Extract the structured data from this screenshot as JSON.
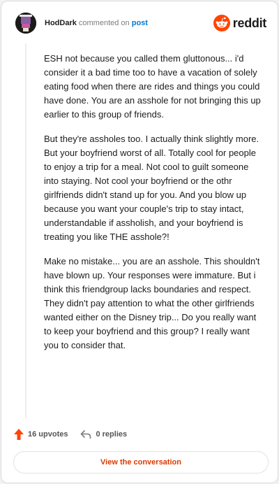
{
  "header": {
    "username": "HodDark",
    "action_text": "commented on",
    "link_text": "post",
    "brand": "reddit"
  },
  "comment": {
    "paragraphs": [
      "ESH not because you called them gluttonous... i'd consider it a bad time too to have a vacation of solely eating food when there are rides and things you could have done. You are an asshole for not bringing this up earlier to this group of friends.",
      "But they're assholes too. I actually think slightly more. But your boyfriend worst of all. Totally cool for people to enjoy a trip for a meal. Not cool to guilt someone into staying. Not cool your boyfriend or the othr girlfriends didn't stand up for you. And you blow up because you want your couple's trip to stay intact, understandable if assholish, and your boyfriend is treating you like THE asshole?!",
      "Make no mistake... you are an asshole. This shouldn't have blown up. Your responses were immature. But i think this friendgroup lacks boundaries and respect. They didn't pay attention to what the other girlfriends wanted either on the Disney trip... Do you really want to keep your boyfriend and this group? I really want you to consider that."
    ]
  },
  "footer": {
    "upvotes": "16 upvotes",
    "replies": "0 replies",
    "cta": "View the conversation"
  },
  "colors": {
    "brand": "#ff4500",
    "link": "#0079d3",
    "cta_text": "#d93a00"
  },
  "icons": [
    "avatar",
    "reddit-logo-icon",
    "upvote-arrow-icon",
    "reply-icon"
  ]
}
